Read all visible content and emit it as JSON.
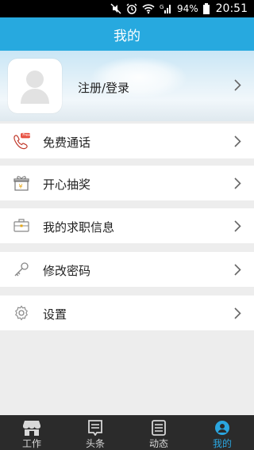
{
  "status_bar": {
    "battery": "94%",
    "time": "20:51"
  },
  "header": {
    "title": "我的"
  },
  "profile": {
    "login_label": "注册/登录"
  },
  "menu": [
    {
      "label": "免费通话",
      "icon": "phone-free-icon"
    },
    {
      "label": "开心抽奖",
      "icon": "gift-icon"
    },
    {
      "label": "我的求职信息",
      "icon": "briefcase-icon"
    },
    {
      "label": "修改密码",
      "icon": "key-icon"
    },
    {
      "label": "设置",
      "icon": "gear-icon"
    }
  ],
  "phone_badge": "Free",
  "bottom_nav": [
    {
      "label": "工作",
      "icon": "shop-icon",
      "active": false
    },
    {
      "label": "头条",
      "icon": "news-icon",
      "active": false
    },
    {
      "label": "动态",
      "icon": "feed-icon",
      "active": false
    },
    {
      "label": "我的",
      "icon": "user-icon",
      "active": true
    }
  ],
  "colors": {
    "header_blue": "#27a9df",
    "nav_active": "#2aa6e0",
    "nav_bg": "#2b2b2b"
  }
}
